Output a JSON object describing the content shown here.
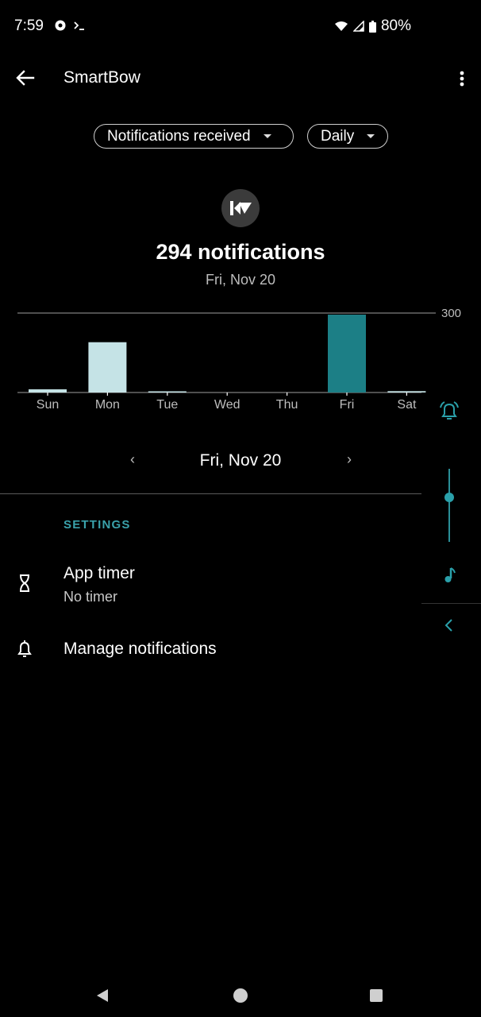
{
  "status_bar": {
    "time": "7:59",
    "battery": "80%"
  },
  "app_bar": {
    "title": "SmartBow"
  },
  "filters": {
    "metric": "Notifications received",
    "period": "Daily"
  },
  "summary": {
    "count_text": "294 notifications",
    "date": "Fri, Nov 20"
  },
  "chart_data": {
    "type": "bar",
    "categories": [
      "Sun",
      "Mon",
      "Tue",
      "Wed",
      "Thu",
      "Fri",
      "Sat"
    ],
    "values": [
      12,
      190,
      2,
      0,
      0,
      294,
      5
    ],
    "ylim": [
      0,
      300
    ],
    "y_ticks": [
      "300"
    ],
    "highlight_index": 5,
    "colors": {
      "normal": "#c5e3e6",
      "highlight": "#1c7f86",
      "axis": "#9e9e9e"
    }
  },
  "date_nav": {
    "date": "Fri, Nov 20"
  },
  "settings": {
    "header": "SETTINGS",
    "app_timer": {
      "title": "App timer",
      "subtitle": "No timer"
    },
    "manage_notifications": {
      "title": "Manage notifications"
    }
  },
  "icons": {
    "back": "arrow-left",
    "menu": "more-vert",
    "timer": "hourglass",
    "bell": "bell",
    "music": "music-note",
    "collapse": "chevron-left"
  },
  "accent_color": "#2aa0aa"
}
